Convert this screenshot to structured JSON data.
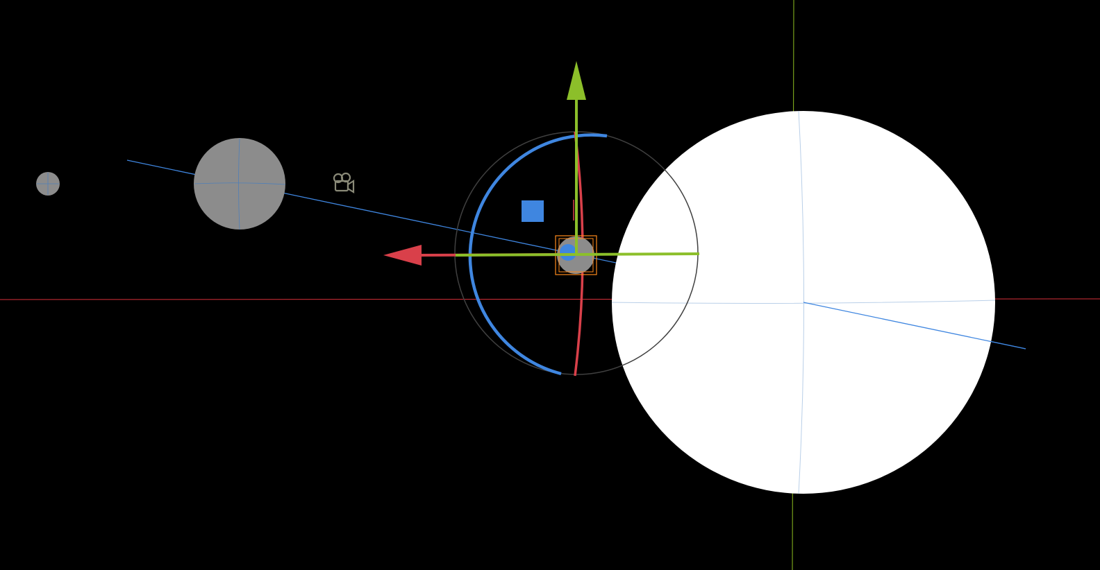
{
  "scene": {
    "background_color": "#000000",
    "objects": [
      {
        "name": "small-moon",
        "kind": "sphere",
        "color": "#8c8c8c"
      },
      {
        "name": "gray-planet",
        "kind": "sphere",
        "color": "#8c8c8c"
      },
      {
        "name": "selected-planet",
        "kind": "sphere",
        "color": "#8c8c8c",
        "selected": true
      },
      {
        "name": "sun",
        "kind": "sphere",
        "color": "#ffffff"
      },
      {
        "name": "scene-camera",
        "kind": "camera",
        "icon": "camera-icon",
        "color": "#8a8a78"
      }
    ],
    "world_axes": {
      "x_color": "#d9303a",
      "y_color": "#8fbf20"
    }
  },
  "gizmo": {
    "mode": "translate-rotate",
    "x_axis_color": "#d9404a",
    "y_axis_color": "#8cbf2a",
    "z_axis_color": "#3f86e0",
    "selection_color": "#ff8a1c",
    "rotation_ring_color": "#404040"
  },
  "orbit": {
    "line_color": "#3f86e0"
  }
}
